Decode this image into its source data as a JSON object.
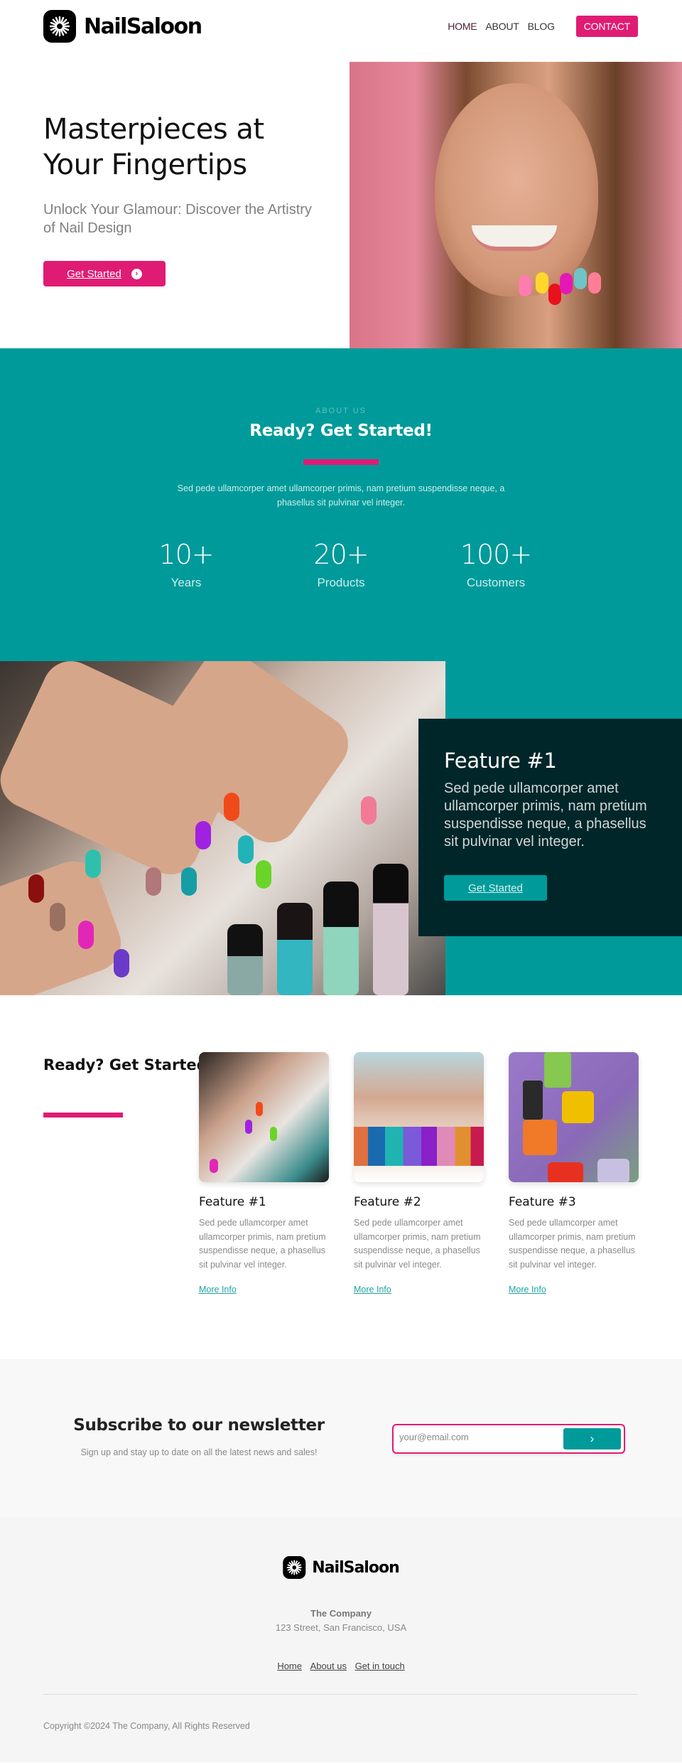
{
  "brand": {
    "name": "NailSaloon",
    "logo_icon": "starburst-icon"
  },
  "nav": {
    "items": [
      {
        "label": "HOME"
      },
      {
        "label": "ABOUT"
      },
      {
        "label": "BLOG"
      }
    ],
    "contact_label": "CONTACT"
  },
  "hero": {
    "title_line1": "Masterpieces at",
    "title_line2": "Your Fingertips",
    "subtitle": "Unlock Your Glamour: Discover the Artistry of Nail Design",
    "cta_label": "Get Started",
    "cta_icon": "chevron-right-circle-icon",
    "image_alt": "Smiling woman showing colorful painted nails"
  },
  "about": {
    "eyebrow": "ABOUT US",
    "title": "Ready? Get Started!",
    "text": "Sed pede ullamcorper amet ullamcorper primis, nam pretium suspendisse neque, a phasellus sit pulvinar vel integer.",
    "stats": [
      {
        "value": "10+",
        "label": "Years"
      },
      {
        "value": "20+",
        "label": "Products"
      },
      {
        "value": "100+",
        "label": "Customers"
      }
    ]
  },
  "feature_highlight": {
    "title": "Feature #1",
    "text": "Sed pede ullamcorper amet ullamcorper primis, nam pretium suspendisse neque, a phasellus sit pulvinar vel integer.",
    "cta_label": "Get Started",
    "image_alt": "Hands with multicolored manicure and nail polish bottles"
  },
  "features": {
    "title": "Ready? Get Started!",
    "cards": [
      {
        "title": "Feature #1",
        "text": "Sed pede ullamcorper amet ullamcorper primis, nam pretium suspendisse neque, a phasellus sit pulvinar vel integer.",
        "link": "More Info",
        "image_alt": "Colorful manicure with polish bottles"
      },
      {
        "title": "Feature #2",
        "text": "Sed pede ullamcorper amet ullamcorper primis, nam pretium suspendisse neque, a phasellus sit pulvinar vel integer.",
        "link": "More Info",
        "image_alt": "Row of colorful nail polish bottles"
      },
      {
        "title": "Feature #3",
        "text": "Sed pede ullamcorper amet ullamcorper primis, nam pretium suspendisse neque, a phasellus sit pulvinar vel integer.",
        "link": "More Info",
        "image_alt": "OPI nail lacquer bottles on purple background"
      }
    ]
  },
  "newsletter": {
    "title": "Subscribe to our newsletter",
    "subtitle": "Sign up and stay up to date on all the latest news and sales!",
    "email_placeholder": "your@email.com",
    "email_value": "",
    "submit_icon": "chevron-right-icon"
  },
  "footer": {
    "company": "The Company",
    "address": "123 Street, San Francisco, USA",
    "links": [
      {
        "label": "Home"
      },
      {
        "label": "About us"
      },
      {
        "label": "Get in touch"
      }
    ],
    "copyright": "Copyright ©2024 The Company, All Rights Reserved"
  },
  "colors": {
    "accent_pink": "#e01b74",
    "teal": "#009a9a",
    "dark_teal": "#00262a",
    "footer_bg": "#f5f5f5"
  }
}
